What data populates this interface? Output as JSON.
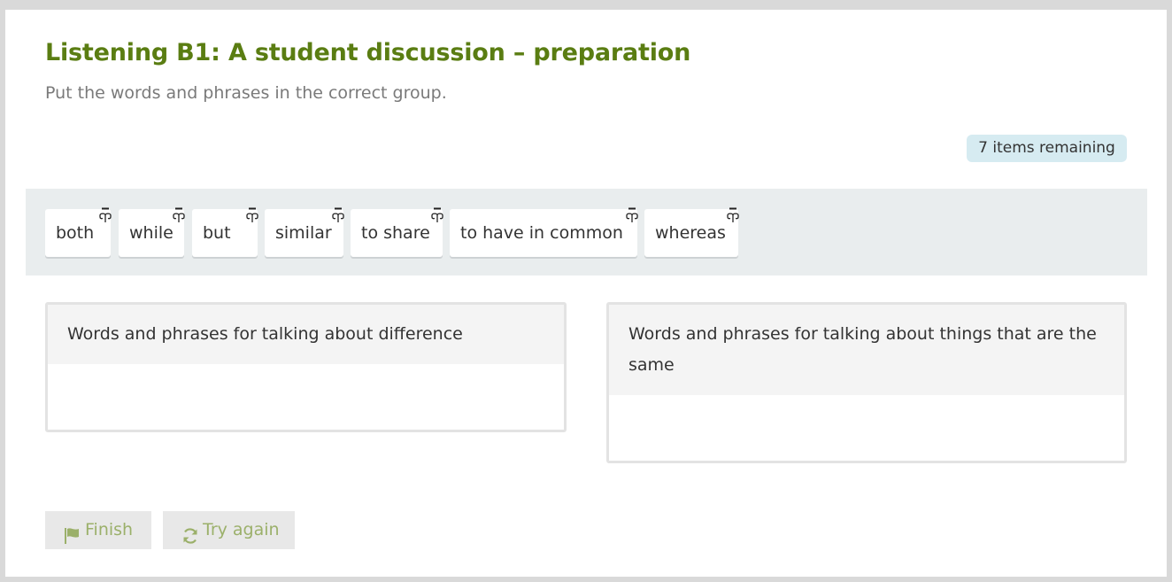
{
  "activity": {
    "title": "Listening B1: A student discussion – preparation",
    "instruction": "Put the words and phrases in the correct group.",
    "remaining_label": "7 items remaining"
  },
  "word_pool": {
    "items": [
      {
        "label": "both",
        "icon": "drag-hand-icon"
      },
      {
        "label": "while",
        "icon": "drag-hand-icon"
      },
      {
        "label": "but",
        "icon": "drag-hand-icon"
      },
      {
        "label": "similar",
        "icon": "drag-hand-icon"
      },
      {
        "label": "to share",
        "icon": "drag-hand-icon"
      },
      {
        "label": "to have in common",
        "icon": "drag-hand-icon"
      },
      {
        "label": "whereas",
        "icon": "drag-hand-icon"
      }
    ]
  },
  "groups": [
    {
      "heading": "Words and phrases for talking about difference"
    },
    {
      "heading": "Words and phrases for talking about things that are the same"
    }
  ],
  "buttons": {
    "finish_label": "Finish",
    "finish_icon": "flag-icon",
    "try_again_label": "Try again",
    "try_again_icon": "refresh-icon"
  },
  "colors": {
    "title": "#5a7d12",
    "button_text": "#9bb06a",
    "badge_background": "#d6ebf1",
    "pool_background": "#e9edee"
  }
}
